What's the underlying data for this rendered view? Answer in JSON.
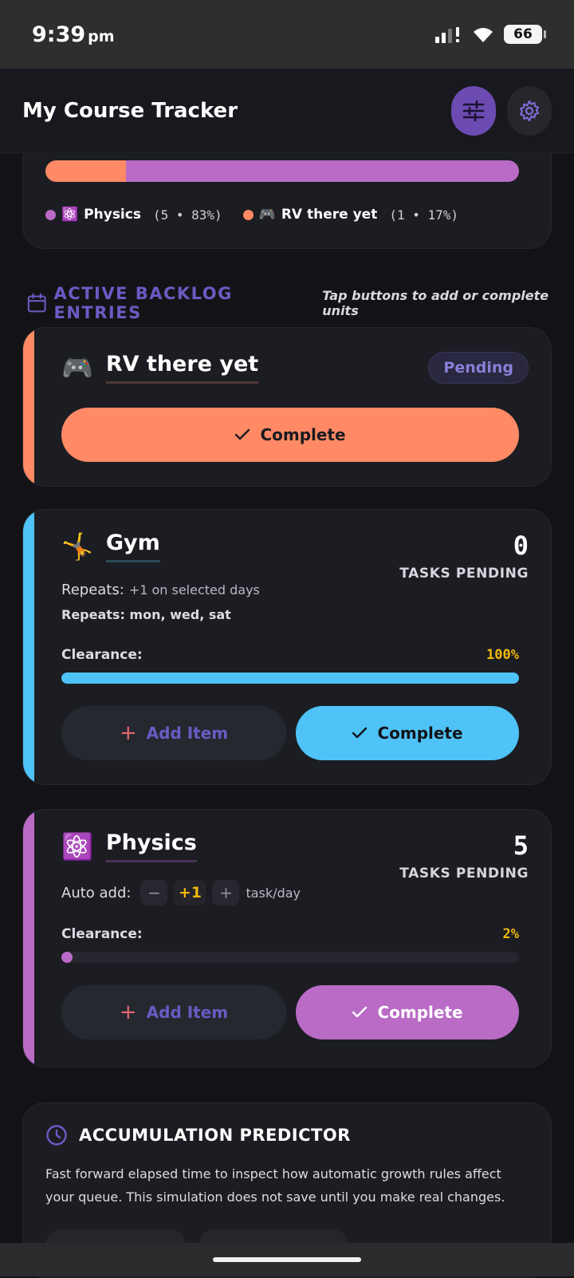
{
  "status": {
    "time": "9:39",
    "ampm": "pm",
    "battery": "66"
  },
  "app": {
    "title": "My Course Tracker"
  },
  "distribution": {
    "legend": [
      {
        "emoji": "⚛️",
        "name": "Physics",
        "stat": "(5 • 83%)",
        "color": "#b96bc6",
        "share": 83
      },
      {
        "emoji": "🎮",
        "name": "RV there yet",
        "stat": "(1 • 17%)",
        "color": "#ff8a65",
        "share": 17
      }
    ]
  },
  "section": {
    "title": "ACTIVE BACKLOG ENTRIES",
    "hint": "Tap buttons to add or complete units"
  },
  "cards": [
    {
      "emoji": "🎮",
      "name": "RV there yet",
      "badge": "Pending",
      "complete_label": "Complete",
      "color": "#ff8a65"
    },
    {
      "emoji": "🤸",
      "name": "Gym",
      "count": "0",
      "count_label": "TASKS PENDING",
      "repeats_label": "Repeats:",
      "repeats_detail": "+1 on selected days",
      "repeats_days": "Repeats: mon, wed, sat",
      "clearance_label": "Clearance:",
      "clearance_pct": "100%",
      "clearance_value": 100,
      "add_label": "Add Item",
      "complete_label": "Complete",
      "color": "#4fc3f7"
    },
    {
      "emoji": "⚛️",
      "name": "Physics",
      "count": "5",
      "count_label": "TASKS PENDING",
      "autoadd_label": "Auto add:",
      "autoadd_value": "+1",
      "autoadd_unit": "task/day",
      "minus": "−",
      "plus": "+",
      "clearance_label": "Clearance:",
      "clearance_pct": "2%",
      "clearance_value": 2,
      "add_label": "Add Item",
      "complete_label": "Complete",
      "color": "#b96bc6"
    }
  ],
  "predictor": {
    "title": "ACCUMULATION PREDICTOR",
    "description": "Fast forward elapsed time to inspect how automatic growth rules affect your queue. This simulation does not save until you make real changes."
  }
}
